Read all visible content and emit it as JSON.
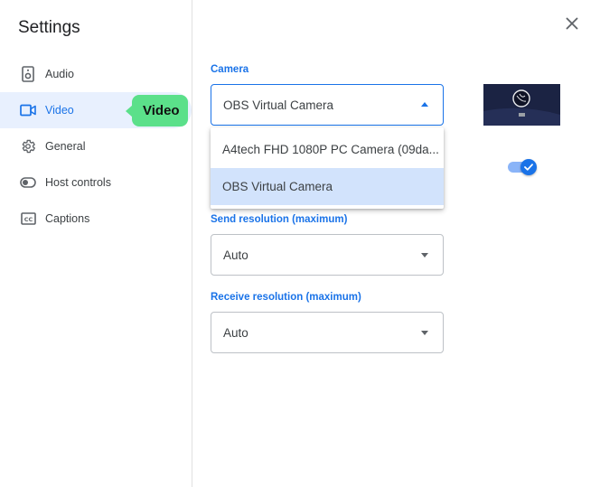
{
  "sidebar": {
    "title": "Settings",
    "items": [
      {
        "label": "Audio",
        "icon": "speaker-icon"
      },
      {
        "label": "Video",
        "icon": "video-camera-icon",
        "active": true
      },
      {
        "label": "General",
        "icon": "gear-icon"
      },
      {
        "label": "Host controls",
        "icon": "toggle-icon"
      },
      {
        "label": "Captions",
        "icon": "closed-captions-icon"
      }
    ]
  },
  "tooltip": {
    "label": "Video"
  },
  "camera": {
    "label": "Camera",
    "selected": "OBS Virtual Camera",
    "options": [
      "A4tech FHD 1080P PC Camera (09da...",
      "OBS Virtual Camera"
    ],
    "expanded": true
  },
  "send_resolution": {
    "label": "Send resolution (maximum)",
    "value": "Auto"
  },
  "receive_resolution": {
    "label": "Receive resolution (maximum)",
    "value": "Auto"
  },
  "mirror_toggle": {
    "on": true
  },
  "colors": {
    "accent": "#1a73e8",
    "active_bg": "#e8f0fe",
    "selected_option": "#d2e3fc",
    "tooltip": "#5be08a"
  }
}
